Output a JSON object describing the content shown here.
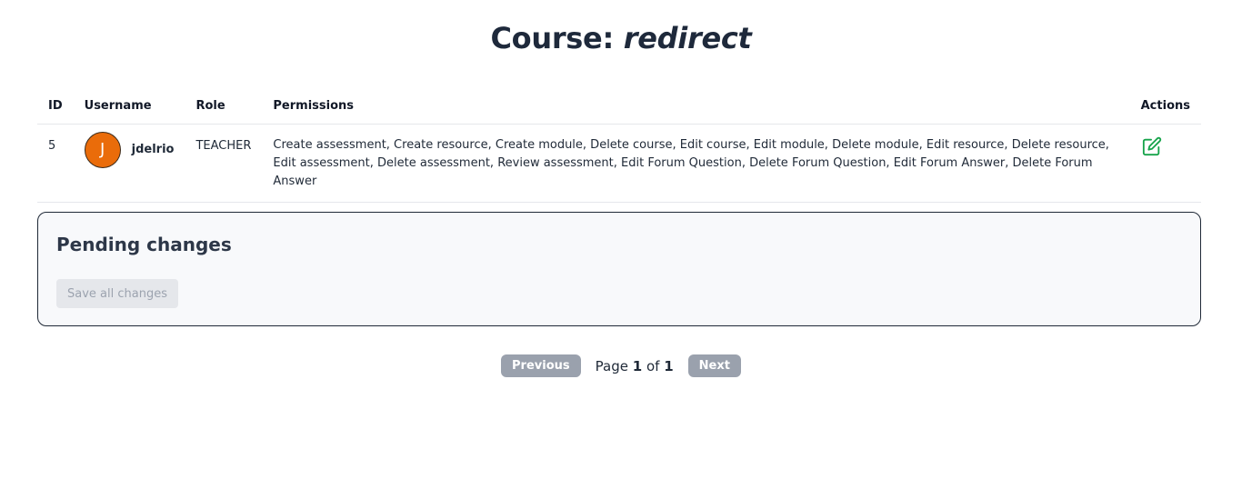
{
  "header": {
    "title_prefix": "Course: ",
    "course_name": "redirect"
  },
  "table": {
    "columns": {
      "id": "ID",
      "username": "Username",
      "role": "Role",
      "permissions": "Permissions",
      "actions": "Actions"
    },
    "rows": [
      {
        "id": "5",
        "avatar_initial": "J",
        "username": "jdelrio",
        "role": "TEACHER",
        "permissions": "Create assessment, Create resource, Create module, Delete course, Edit course, Edit module, Delete module, Edit resource, Delete resource, Edit assessment, Delete assessment, Review assessment, Edit Forum Question, Delete Forum Question, Edit Forum Answer, Delete Forum Answer",
        "action_icon": "edit-icon"
      }
    ]
  },
  "pending": {
    "title": "Pending changes",
    "save_label": "Save all changes"
  },
  "pagination": {
    "previous_label": "Previous",
    "page_word": "Page",
    "current_page": "1",
    "of_word": "of",
    "total_pages": "1",
    "next_label": "Next"
  },
  "colors": {
    "avatar": "#ea6c0a",
    "edit_icon": "#16a34a",
    "pager_button": "#9aa1ad",
    "disabled_button": "#e5e7eb"
  }
}
